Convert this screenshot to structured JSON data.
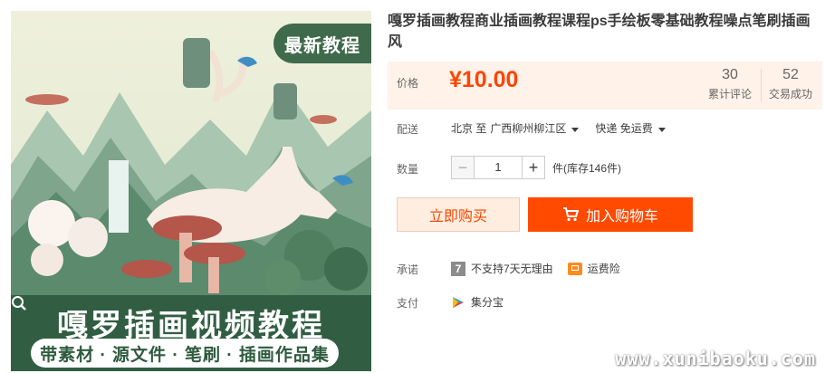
{
  "image": {
    "badge": "最新教程",
    "banner_title": "嘎罗插画视频教程",
    "banner_subtitle": "带素材 · 源文件 · 笔刷 · 插画作品集"
  },
  "product": {
    "title": "嘎罗插画教程商业插画教程课程ps手绘板零基础教程噪点笔刷插画风"
  },
  "price": {
    "label": "价格",
    "value": "¥10.00"
  },
  "stats": [
    {
      "num": "30",
      "label": "累计评论"
    },
    {
      "num": "52",
      "label": "交易成功"
    }
  ],
  "delivery": {
    "label": "配送",
    "from": "北京 至",
    "to": "广西柳州柳江区",
    "method": "快递 免运费"
  },
  "quantity": {
    "label": "数量",
    "value": "1",
    "stock": "件(库存146件)"
  },
  "buttons": {
    "buy_now": "立即购买",
    "add_cart": "加入购物车"
  },
  "promise": {
    "label": "承诺",
    "no_return": "不支持7天无理由",
    "freight_insurance": "运费险"
  },
  "payment": {
    "label": "支付",
    "method": "集分宝"
  },
  "watermark": "www.xunibaoku.com",
  "colors": {
    "accent": "#ff4400",
    "price_bg": "#fff2e8",
    "banner": "#315e43"
  }
}
